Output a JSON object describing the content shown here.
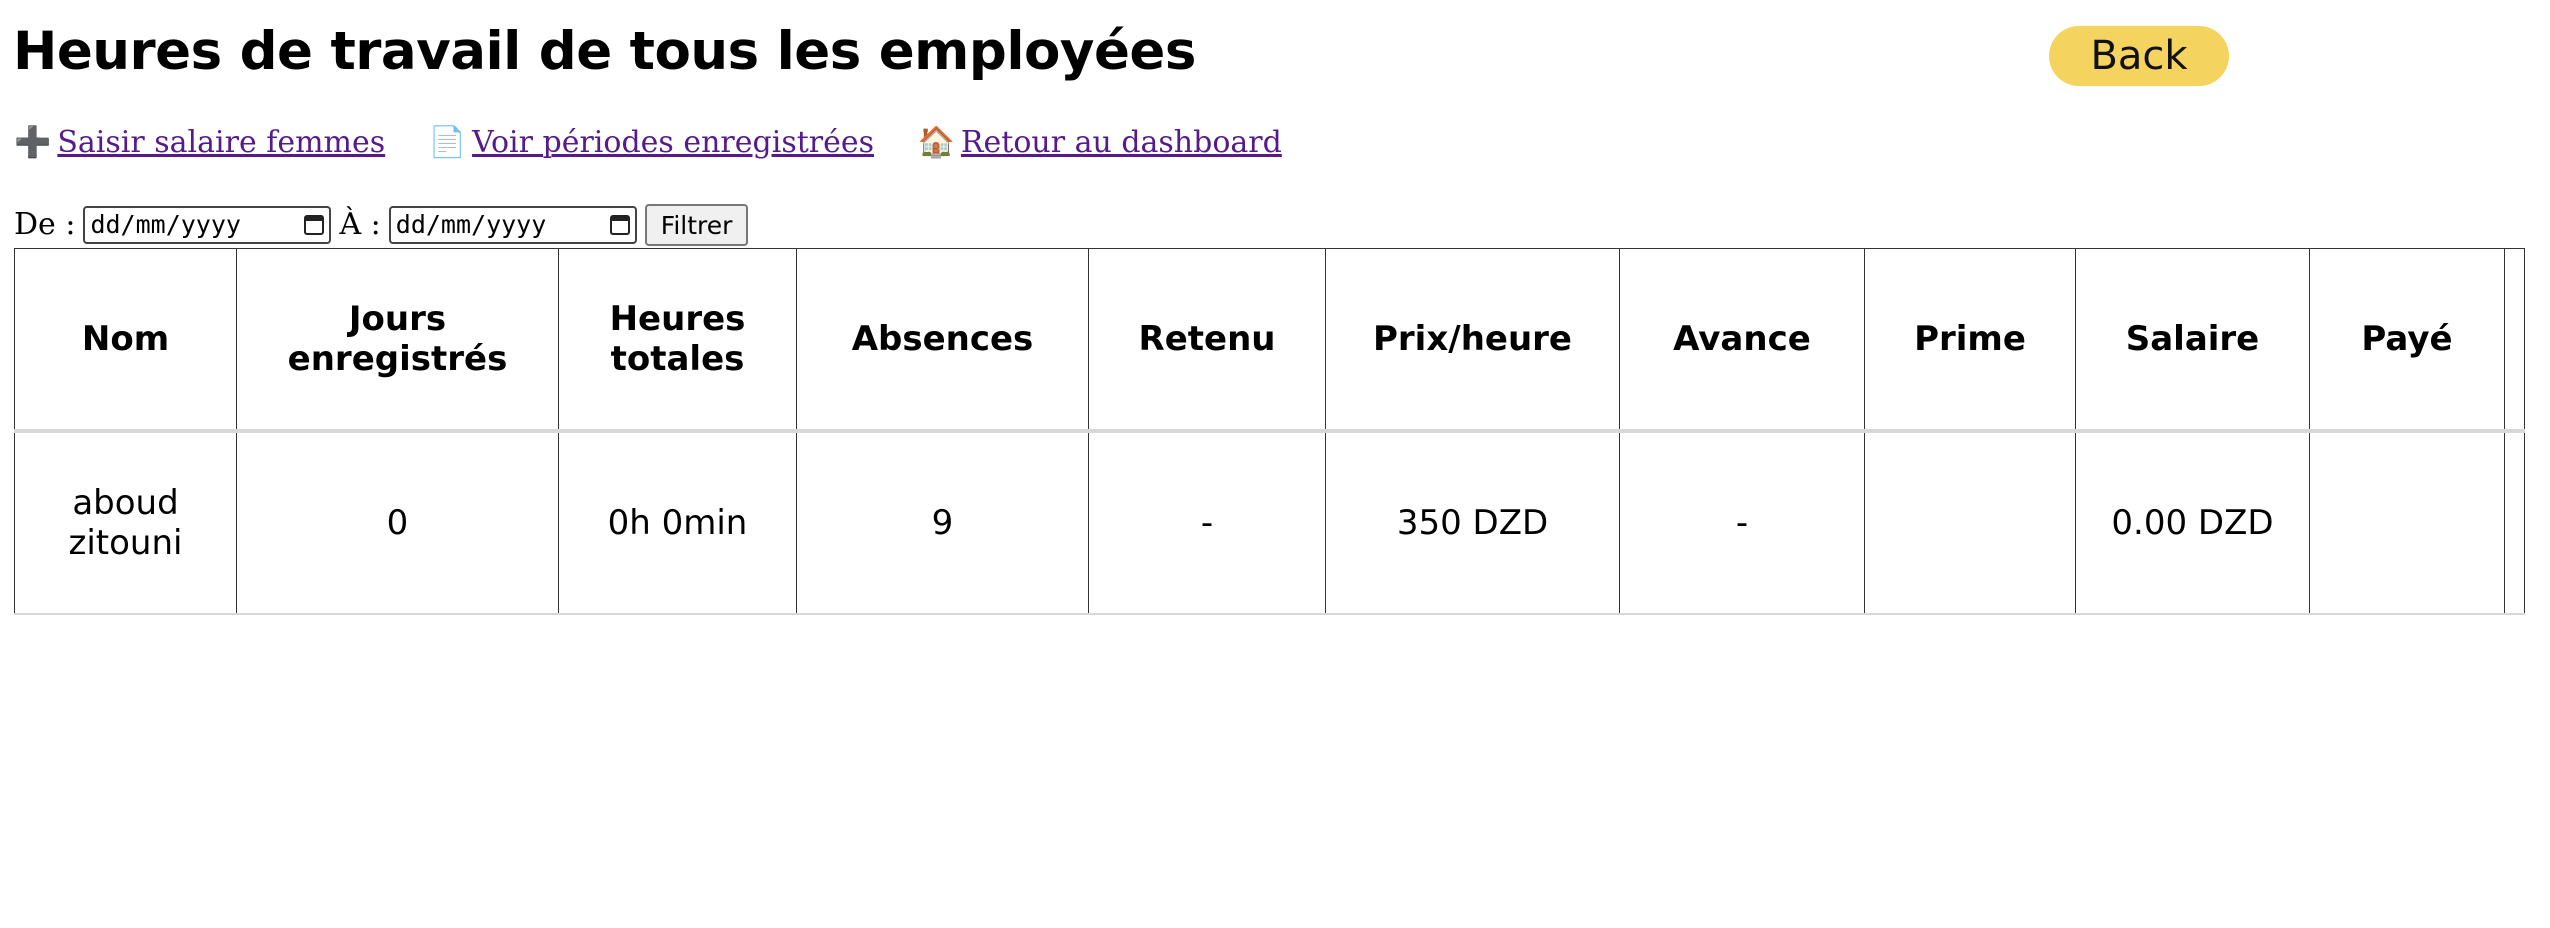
{
  "page": {
    "title": "Heures de travail de tous les employées",
    "back_label": "Back"
  },
  "nav": {
    "links": [
      {
        "icon": "plus-icon",
        "glyph": "➕",
        "label": "Saisir salaire femmes"
      },
      {
        "icon": "document-icon",
        "glyph": "📄",
        "label": "Voir périodes enregistrées"
      },
      {
        "icon": "house-icon",
        "glyph": "🏠",
        "label": "Retour au dashboard"
      }
    ]
  },
  "filter": {
    "from_label": "De :",
    "to_label": "À :",
    "from_value": "dd/mm/yyyy",
    "to_value": "dd/mm/yyyy",
    "button_label": "Filtrer"
  },
  "table": {
    "headers": [
      "Nom",
      "Jours enregistrés",
      "Heures totales",
      "Absences",
      "Retenu",
      "Prix/heure",
      "Avance",
      "Prime",
      "Salaire",
      "Payé"
    ],
    "rows": [
      [
        "aboud zitouni",
        "0",
        "0h 0min",
        "9",
        "-",
        "350 DZD",
        "-",
        "",
        "0.00 DZD",
        ""
      ]
    ]
  },
  "colors": {
    "back_button": "#f4d35e",
    "link": "#551a8b"
  }
}
